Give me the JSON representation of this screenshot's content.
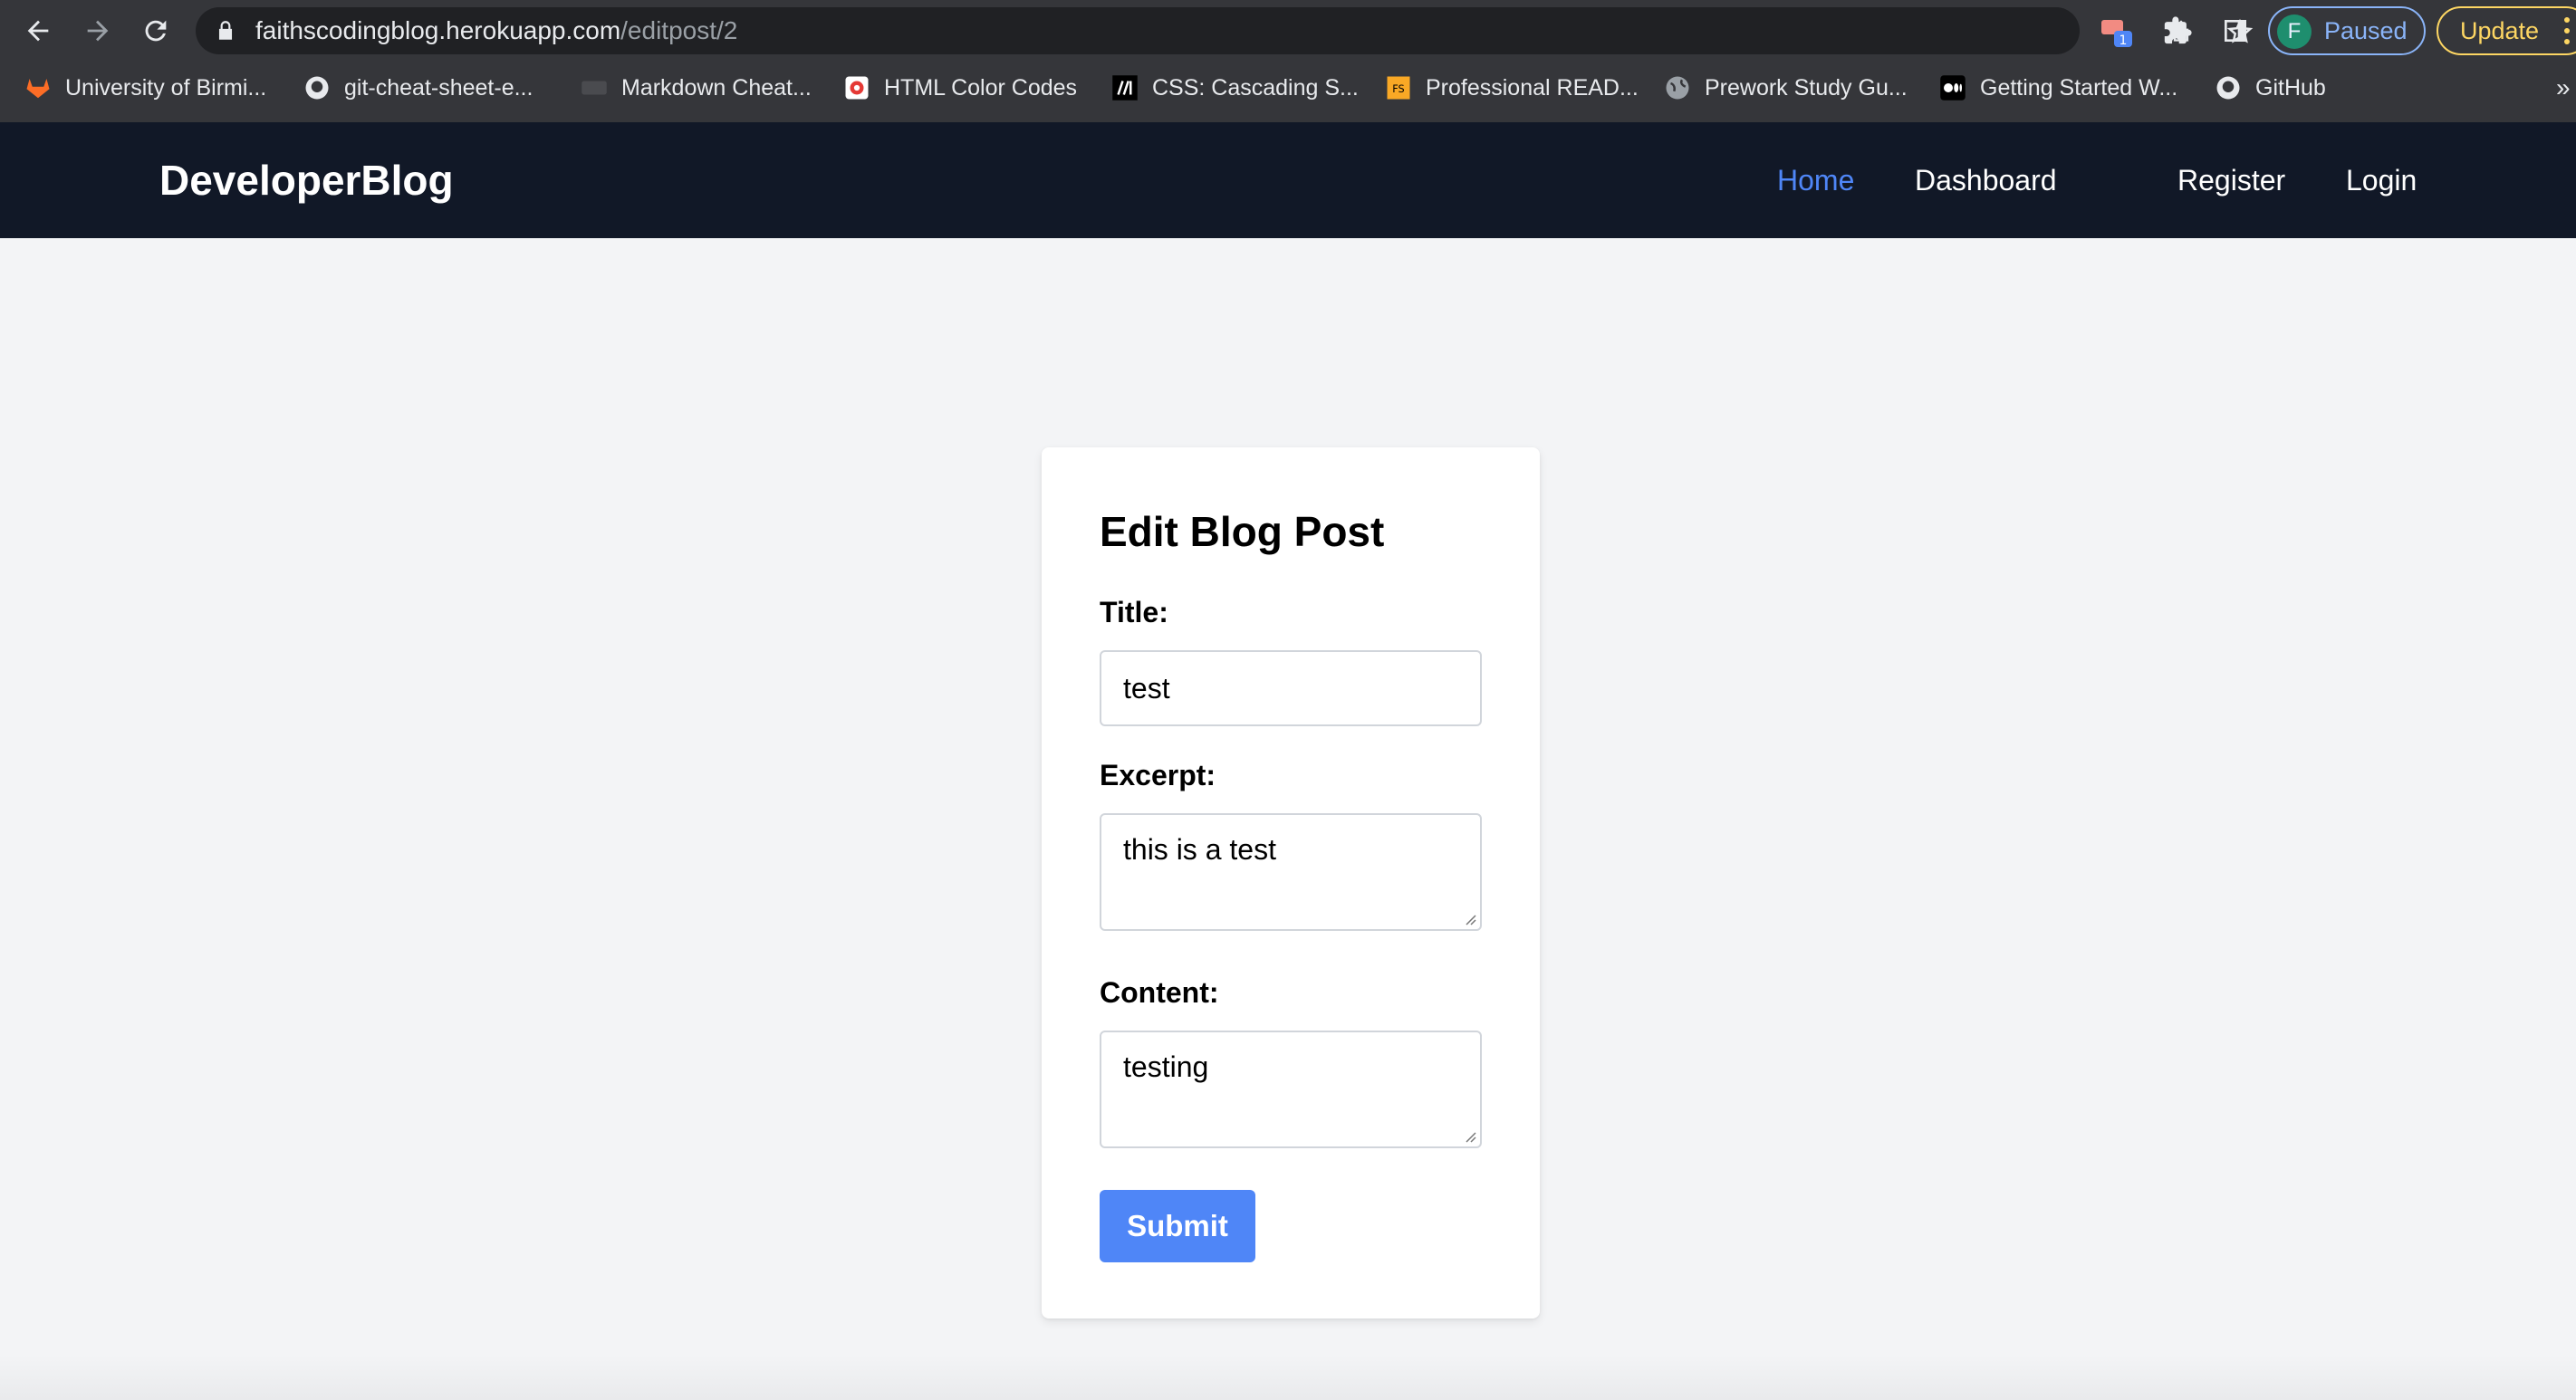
{
  "browser": {
    "url_host": "faithscodingblog.herokuapp.com",
    "url_path": "/editpost/2",
    "extension_badge": "1",
    "profile_initial": "F",
    "profile_status": "Paused",
    "update_label": "Update",
    "bookmarks": [
      {
        "label": "University of Birmi...",
        "icon": "gitlab-icon"
      },
      {
        "label": "git-cheat-sheet-e...",
        "icon": "github-icon"
      },
      {
        "label": "Markdown Cheat...",
        "icon": "markdown-icon"
      },
      {
        "label": "HTML Color Codes",
        "icon": "html-color-codes-icon"
      },
      {
        "label": "CSS: Cascading S...",
        "icon": "mdn-icon"
      },
      {
        "label": "Professional READ...",
        "icon": "readme-icon"
      },
      {
        "label": "Prework Study Gu...",
        "icon": "globe-icon"
      },
      {
        "label": "Getting Started W...",
        "icon": "medium-icon"
      },
      {
        "label": "GitHub",
        "icon": "github-icon"
      }
    ],
    "bookmarks_more": "»"
  },
  "site": {
    "brand": "DeveloperBlog",
    "nav": {
      "home": "Home",
      "dashboard": "Dashboard",
      "register": "Register",
      "login": "Login"
    }
  },
  "form": {
    "heading": "Edit Blog Post",
    "title_label": "Title:",
    "title_value": "test",
    "excerpt_label": "Excerpt:",
    "excerpt_value": "this is a test",
    "content_label": "Content:",
    "content_value": "testing",
    "submit_label": "Submit"
  },
  "colors": {
    "navbar": "#111827",
    "accent": "#4f86f7",
    "page_bg": "#f3f4f6"
  }
}
